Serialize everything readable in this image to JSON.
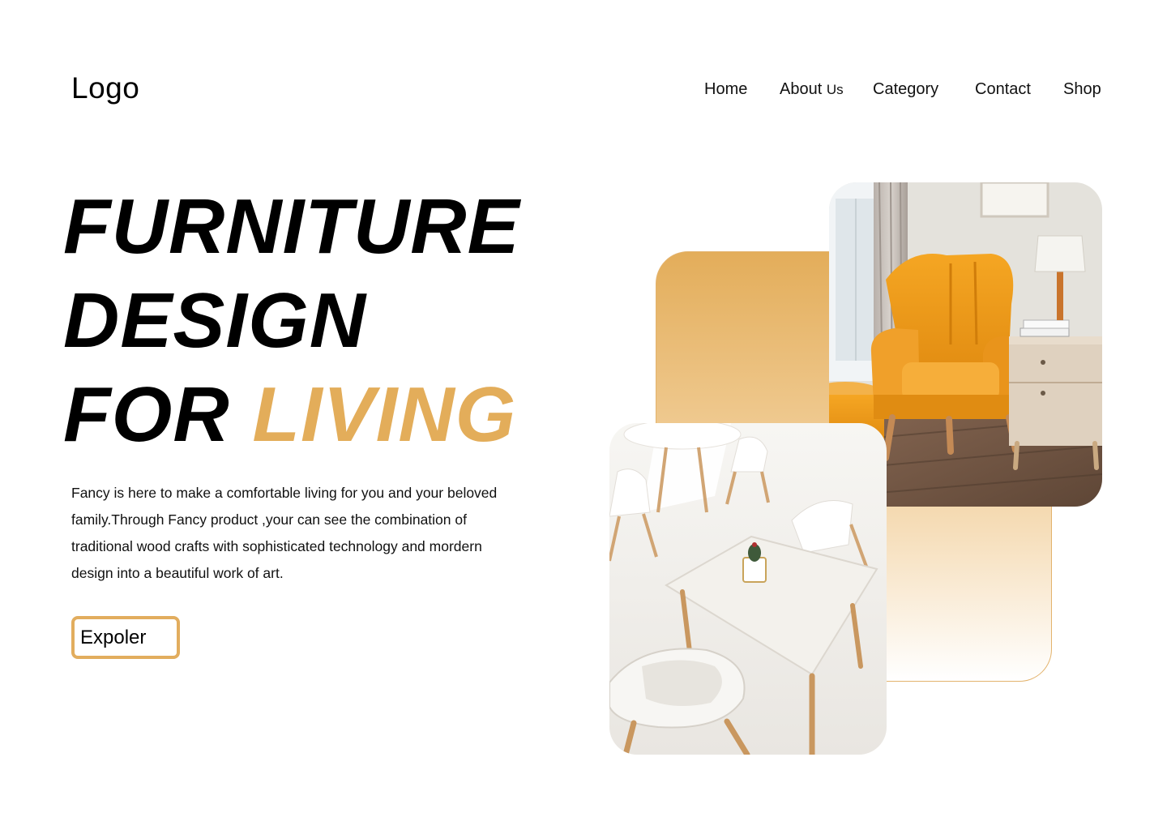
{
  "header": {
    "logo": "Logo",
    "nav": {
      "home": "Home",
      "about": "About",
      "about_us": "Us",
      "category": "Category",
      "contact": "Contact",
      "shop": "Shop"
    }
  },
  "hero": {
    "line1": "FURNITURE",
    "line2": "DESIGN",
    "line3_plain": "FOR",
    "line3_accent": "LIVING",
    "description": "Fancy is here to  make a comfortable living for you and  your beloved  family.Through Fancy product ,your can see the combination of traditional wood  crafts with sophisticated technology and mordern design into a beautiful work of art.",
    "cta_label": "Expoler"
  },
  "colors": {
    "accent": "#E3AD5A",
    "text": "#000000",
    "background": "#FFFFFF"
  },
  "images": {
    "chair_photo": "yellow-armchair-with-side-table-and-lamp",
    "table_photo": "white-table-with-white-chairs-and-small-cactus"
  }
}
